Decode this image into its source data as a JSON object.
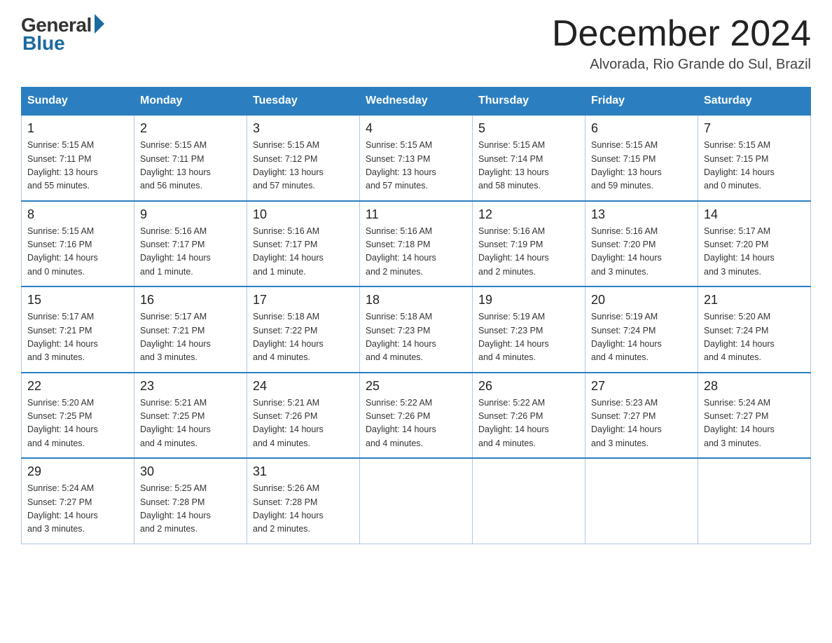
{
  "header": {
    "logo_general": "General",
    "logo_blue": "Blue",
    "month_title": "December 2024",
    "location": "Alvorada, Rio Grande do Sul, Brazil"
  },
  "days_of_week": [
    "Sunday",
    "Monday",
    "Tuesday",
    "Wednesday",
    "Thursday",
    "Friday",
    "Saturday"
  ],
  "weeks": [
    [
      {
        "day": "1",
        "info": "Sunrise: 5:15 AM\nSunset: 7:11 PM\nDaylight: 13 hours\nand 55 minutes."
      },
      {
        "day": "2",
        "info": "Sunrise: 5:15 AM\nSunset: 7:11 PM\nDaylight: 13 hours\nand 56 minutes."
      },
      {
        "day": "3",
        "info": "Sunrise: 5:15 AM\nSunset: 7:12 PM\nDaylight: 13 hours\nand 57 minutes."
      },
      {
        "day": "4",
        "info": "Sunrise: 5:15 AM\nSunset: 7:13 PM\nDaylight: 13 hours\nand 57 minutes."
      },
      {
        "day": "5",
        "info": "Sunrise: 5:15 AM\nSunset: 7:14 PM\nDaylight: 13 hours\nand 58 minutes."
      },
      {
        "day": "6",
        "info": "Sunrise: 5:15 AM\nSunset: 7:15 PM\nDaylight: 13 hours\nand 59 minutes."
      },
      {
        "day": "7",
        "info": "Sunrise: 5:15 AM\nSunset: 7:15 PM\nDaylight: 14 hours\nand 0 minutes."
      }
    ],
    [
      {
        "day": "8",
        "info": "Sunrise: 5:15 AM\nSunset: 7:16 PM\nDaylight: 14 hours\nand 0 minutes."
      },
      {
        "day": "9",
        "info": "Sunrise: 5:16 AM\nSunset: 7:17 PM\nDaylight: 14 hours\nand 1 minute."
      },
      {
        "day": "10",
        "info": "Sunrise: 5:16 AM\nSunset: 7:17 PM\nDaylight: 14 hours\nand 1 minute."
      },
      {
        "day": "11",
        "info": "Sunrise: 5:16 AM\nSunset: 7:18 PM\nDaylight: 14 hours\nand 2 minutes."
      },
      {
        "day": "12",
        "info": "Sunrise: 5:16 AM\nSunset: 7:19 PM\nDaylight: 14 hours\nand 2 minutes."
      },
      {
        "day": "13",
        "info": "Sunrise: 5:16 AM\nSunset: 7:20 PM\nDaylight: 14 hours\nand 3 minutes."
      },
      {
        "day": "14",
        "info": "Sunrise: 5:17 AM\nSunset: 7:20 PM\nDaylight: 14 hours\nand 3 minutes."
      }
    ],
    [
      {
        "day": "15",
        "info": "Sunrise: 5:17 AM\nSunset: 7:21 PM\nDaylight: 14 hours\nand 3 minutes."
      },
      {
        "day": "16",
        "info": "Sunrise: 5:17 AM\nSunset: 7:21 PM\nDaylight: 14 hours\nand 3 minutes."
      },
      {
        "day": "17",
        "info": "Sunrise: 5:18 AM\nSunset: 7:22 PM\nDaylight: 14 hours\nand 4 minutes."
      },
      {
        "day": "18",
        "info": "Sunrise: 5:18 AM\nSunset: 7:23 PM\nDaylight: 14 hours\nand 4 minutes."
      },
      {
        "day": "19",
        "info": "Sunrise: 5:19 AM\nSunset: 7:23 PM\nDaylight: 14 hours\nand 4 minutes."
      },
      {
        "day": "20",
        "info": "Sunrise: 5:19 AM\nSunset: 7:24 PM\nDaylight: 14 hours\nand 4 minutes."
      },
      {
        "day": "21",
        "info": "Sunrise: 5:20 AM\nSunset: 7:24 PM\nDaylight: 14 hours\nand 4 minutes."
      }
    ],
    [
      {
        "day": "22",
        "info": "Sunrise: 5:20 AM\nSunset: 7:25 PM\nDaylight: 14 hours\nand 4 minutes."
      },
      {
        "day": "23",
        "info": "Sunrise: 5:21 AM\nSunset: 7:25 PM\nDaylight: 14 hours\nand 4 minutes."
      },
      {
        "day": "24",
        "info": "Sunrise: 5:21 AM\nSunset: 7:26 PM\nDaylight: 14 hours\nand 4 minutes."
      },
      {
        "day": "25",
        "info": "Sunrise: 5:22 AM\nSunset: 7:26 PM\nDaylight: 14 hours\nand 4 minutes."
      },
      {
        "day": "26",
        "info": "Sunrise: 5:22 AM\nSunset: 7:26 PM\nDaylight: 14 hours\nand 4 minutes."
      },
      {
        "day": "27",
        "info": "Sunrise: 5:23 AM\nSunset: 7:27 PM\nDaylight: 14 hours\nand 3 minutes."
      },
      {
        "day": "28",
        "info": "Sunrise: 5:24 AM\nSunset: 7:27 PM\nDaylight: 14 hours\nand 3 minutes."
      }
    ],
    [
      {
        "day": "29",
        "info": "Sunrise: 5:24 AM\nSunset: 7:27 PM\nDaylight: 14 hours\nand 3 minutes."
      },
      {
        "day": "30",
        "info": "Sunrise: 5:25 AM\nSunset: 7:28 PM\nDaylight: 14 hours\nand 2 minutes."
      },
      {
        "day": "31",
        "info": "Sunrise: 5:26 AM\nSunset: 7:28 PM\nDaylight: 14 hours\nand 2 minutes."
      },
      {
        "day": "",
        "info": ""
      },
      {
        "day": "",
        "info": ""
      },
      {
        "day": "",
        "info": ""
      },
      {
        "day": "",
        "info": ""
      }
    ]
  ]
}
